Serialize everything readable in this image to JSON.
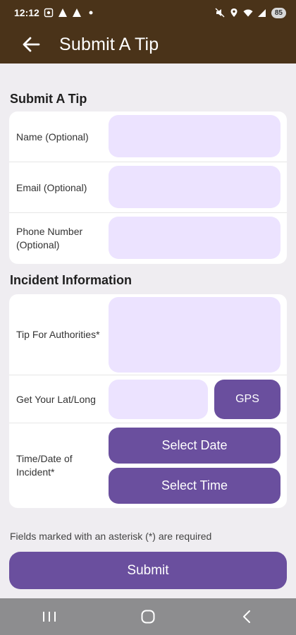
{
  "status_bar": {
    "time": "12:12",
    "battery": "85",
    "left_icons": [
      "screenshot-icon",
      "warning-icon",
      "warning-icon",
      "dot-icon"
    ],
    "right_icons": [
      "mute-icon",
      "location-icon",
      "wifi-icon",
      "signal-icon"
    ]
  },
  "app_bar": {
    "title": "Submit A Tip"
  },
  "personal_section": {
    "title": "Submit A Tip",
    "name_label": "Name (Optional)",
    "email_label": "Email (Optional)",
    "phone_label": "Phone Number (Optional)"
  },
  "incident_section": {
    "title": "Incident Information",
    "tip_label": "Tip For Authorities*",
    "latlong_label": "Get Your Lat/Long",
    "gps_button": "GPS",
    "datetime_label": "Time/Date of Incident*",
    "select_date_button": "Select Date",
    "select_time_button": "Select Time"
  },
  "required_hint": "Fields marked with an asterisk (*) are required",
  "submit_button": "Submit",
  "colors": {
    "header": "#4a3319",
    "accent": "#6a4f9e",
    "field_fill": "#ece3ff",
    "background": "#efedf1"
  }
}
